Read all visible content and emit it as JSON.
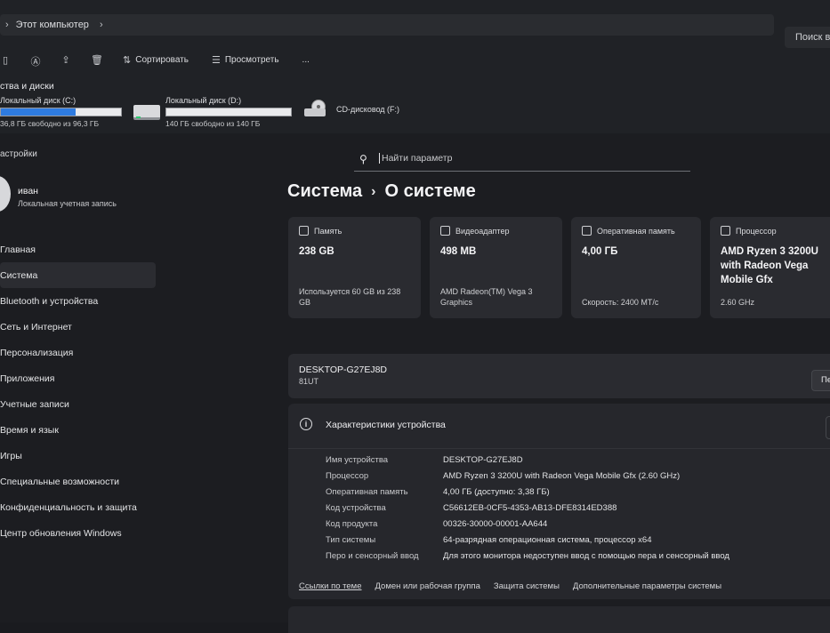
{
  "explorer": {
    "address": "Этот компьютер",
    "search_placeholder": "Поиск в",
    "toolbar": {
      "sort": "Сортировать",
      "view": "Просмотреть",
      "more": "..."
    },
    "drives_section": "ства и диски",
    "drives": [
      {
        "name": "Локальный диск (C:)",
        "free": "36,8 ГБ свободно из 96,3 ГБ",
        "used_fraction": 0.62
      },
      {
        "name": "Локальный диск (D:)",
        "free": "140 ГБ свободно из 140 ГБ",
        "used_fraction": 0.0
      },
      {
        "name": "CD-дисковод (F:)"
      }
    ]
  },
  "settings": {
    "app_title": "астройки",
    "user": {
      "name": "иван",
      "account": "Локальная учетная запись"
    },
    "nav": [
      "Главная",
      "Система",
      "Bluetooth и устройства",
      "Сеть и Интернет",
      "Персонализация",
      "Приложения",
      "Учетные записи",
      "Время и язык",
      "Игры",
      "Специальные возможности",
      "Конфиденциальность и защита",
      "Центр обновления Windows"
    ],
    "search_placeholder": "Найти параметр",
    "breadcrumb": {
      "parent": "Система",
      "separator": "›",
      "current": "О системе"
    },
    "cards": [
      {
        "label": "Память",
        "value": "238 GB",
        "sub": "Используется 60 GB из 238 GB"
      },
      {
        "label": "Видеоадаптер",
        "value": "498 MB",
        "sub": "AMD Radeon(TM) Vega 3 Graphics"
      },
      {
        "label": "Оперативная память",
        "value": "4,00 ГБ",
        "sub": "Скорость: 2400 МТ/с"
      },
      {
        "label": "Процессор",
        "value": "AMD Ryzen 3 3200U with Radeon Vega Mobile Gfx",
        "sub": "2.60 GHz"
      }
    ],
    "device": {
      "name": "DESKTOP-G27EJ8D",
      "model": "81UT",
      "rename": "Пе"
    },
    "specs_title": "Характеристики устройства",
    "specs": [
      {
        "k": "Имя устройства",
        "v": "DESKTOP-G27EJ8D"
      },
      {
        "k": "Процессор",
        "v": "AMD Ryzen 3 3200U with Radeon Vega Mobile Gfx   (2.60 GHz)"
      },
      {
        "k": "Оперативная память",
        "v": "4,00 ГБ (доступно: 3,38 ГБ)"
      },
      {
        "k": "Код устройства",
        "v": "C56612EB-0CF5-4353-AB13-DFE8314ED388"
      },
      {
        "k": "Код продукта",
        "v": "00326-30000-00001-AA644"
      },
      {
        "k": "Тип системы",
        "v": "64-разрядная операционная система, процессор x64"
      },
      {
        "k": "Перо и сенсорный ввод",
        "v": "Для этого монитора недоступен ввод с помощью пера и сенсорный ввод"
      }
    ],
    "links": [
      "Ссылки по теме",
      "Домен или рабочая группа",
      "Защита системы",
      "Дополнительные параметры системы"
    ]
  }
}
